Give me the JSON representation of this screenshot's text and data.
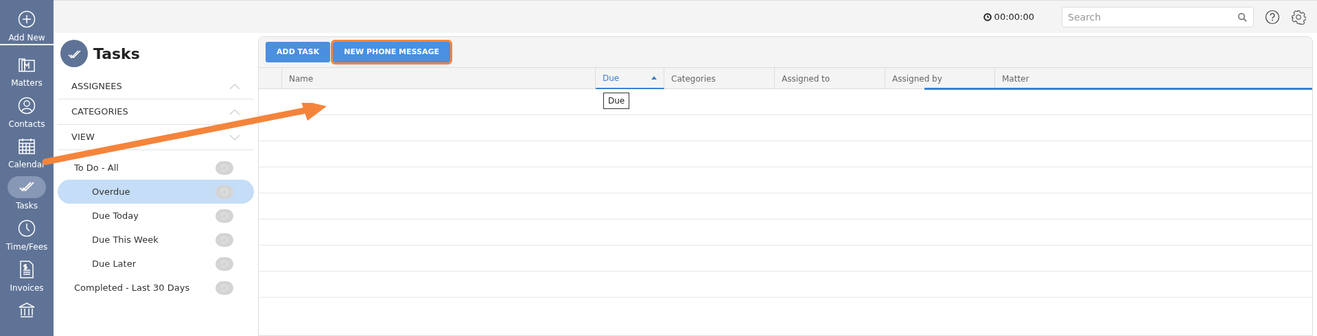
{
  "nav": [
    {
      "label": "Add New",
      "kind": "plus",
      "selected": false
    },
    {
      "label": "Matters",
      "kind": "matters",
      "selected": false
    },
    {
      "label": "Contacts",
      "kind": "contacts",
      "selected": false
    },
    {
      "label": "Calendar",
      "kind": "calendar",
      "selected": false
    },
    {
      "label": "Tasks",
      "kind": "tasks",
      "selected": true
    },
    {
      "label": "Time/Fees",
      "kind": "clock",
      "selected": false
    },
    {
      "label": "Invoices",
      "kind": "invoice",
      "selected": false
    },
    {
      "kind": "bank",
      "selected": false
    }
  ],
  "top_bar": {
    "timer": "00:00:00",
    "search": {
      "placeholder": "Search"
    }
  },
  "page_title": "Tasks",
  "filter_sections": [
    {
      "label": "ASSIGNEES",
      "expanded": false
    },
    {
      "label": "CATEGORIES",
      "expanded": false
    },
    {
      "label": "VIEW",
      "expanded": true
    }
  ],
  "views": [
    {
      "label": "To Do - All",
      "selected": false,
      "children": [
        {
          "label": "Overdue",
          "selected": true
        },
        {
          "label": "Due Today",
          "selected": false
        },
        {
          "label": "Due This Week",
          "selected": false
        },
        {
          "label": "Due Later",
          "selected": false
        }
      ]
    },
    {
      "label": "Completed - Last 30 Days",
      "selected": false
    }
  ],
  "toolbar": [
    {
      "label": "ADD TASK",
      "highlighted": false
    },
    {
      "label": "NEW PHONE MESSAGE",
      "highlighted": true
    }
  ],
  "table": {
    "columns": [
      {
        "label": "Name",
        "sorted": false
      },
      {
        "label": "Due",
        "sorted": true
      },
      {
        "label": "Categories",
        "sorted": false
      },
      {
        "label": "Assigned to",
        "sorted": false
      },
      {
        "label": "Assigned by",
        "sorted": false
      },
      {
        "label": "Matter",
        "sorted": false
      }
    ],
    "tooltip": "Due"
  }
}
